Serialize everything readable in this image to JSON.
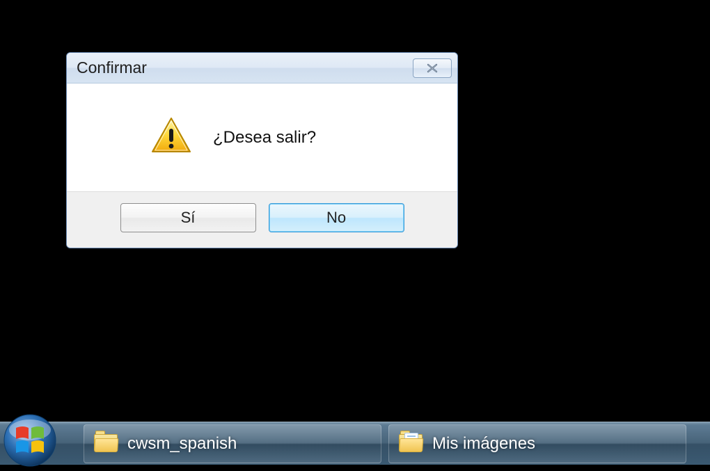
{
  "dialog": {
    "title": "Confirmar",
    "message": "¿Desea salir?",
    "yes_label": "Sí",
    "no_label": "No"
  },
  "taskbar": {
    "items": [
      {
        "label": "cwsm_spanish",
        "icon": "folder"
      },
      {
        "label": "Mis imágenes",
        "icon": "folder-doc"
      }
    ]
  }
}
